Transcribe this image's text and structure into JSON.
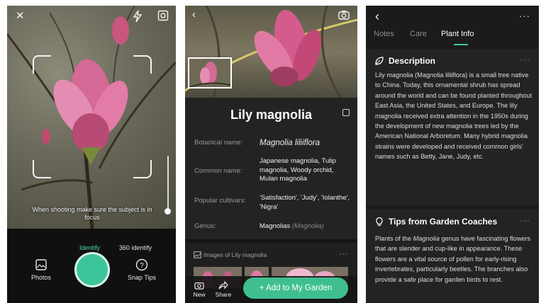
{
  "camera_screen": {
    "icons": [
      "close-icon",
      "flash-icon",
      "gallery-icon"
    ],
    "hint": "When shooting make sure the subject is in focus",
    "modes": [
      "Identify",
      "360 identify"
    ],
    "photos_label": "Photos",
    "snap_tips_label": "Snap Tips",
    "accent": "#3cc59a"
  },
  "result_screen": {
    "plant_name": "Lily magnolia",
    "fields": [
      {
        "key": "Botanical name:",
        "value": "Magnolia liliiflora"
      },
      {
        "key": "Common name:",
        "value": "Japanese magnolia, Tulip magnolia, Woody orchid, Mulan magnolia"
      },
      {
        "key": "Popular cultivars:",
        "value": "'Satisfaction', 'Judy', 'Iolanthe', 'Nigra'"
      },
      {
        "key": "Genus:",
        "value": "Magnolias",
        "secondary": "(Magnolia)"
      }
    ],
    "images_title": "Images of Lily magnolia",
    "new_label": "New",
    "share_label": "Share",
    "add_label": "+ Add to My Garden",
    "accent": "#3fbf8f"
  },
  "info_screen": {
    "tabs": [
      "Notes",
      "Care",
      "Plant Info"
    ],
    "active_tab": "Plant Info",
    "description_title": "Description",
    "description_text": "Lily magnolia (Magnolia liliiflora) is a small tree native to China. Today, this ornamental shrub has spread around the world and can be found planted throughout East Asia, the United States, and Europe. The lily magnolia received extra attention in the 1950s during the development of new magnolia trees led by the American National Arboretum. Many hybrid magnolia strains were developed and received common girls' names such as Betty, Jane, Judy, etc.",
    "tips_title": "Tips from Garden Coaches",
    "tips_text_1": "Plants of the ",
    "tips_text_italic": "Magnolia",
    "tips_text_2": " genus have fascinating flowers that are slender and cup-like in appearance. These flowers are a vital source of pollen for early-rising invertebrates, particularly beetles. The branches also provide a safe place for garden birds to rest.",
    "dots": "···",
    "accent": "#40c99a"
  }
}
